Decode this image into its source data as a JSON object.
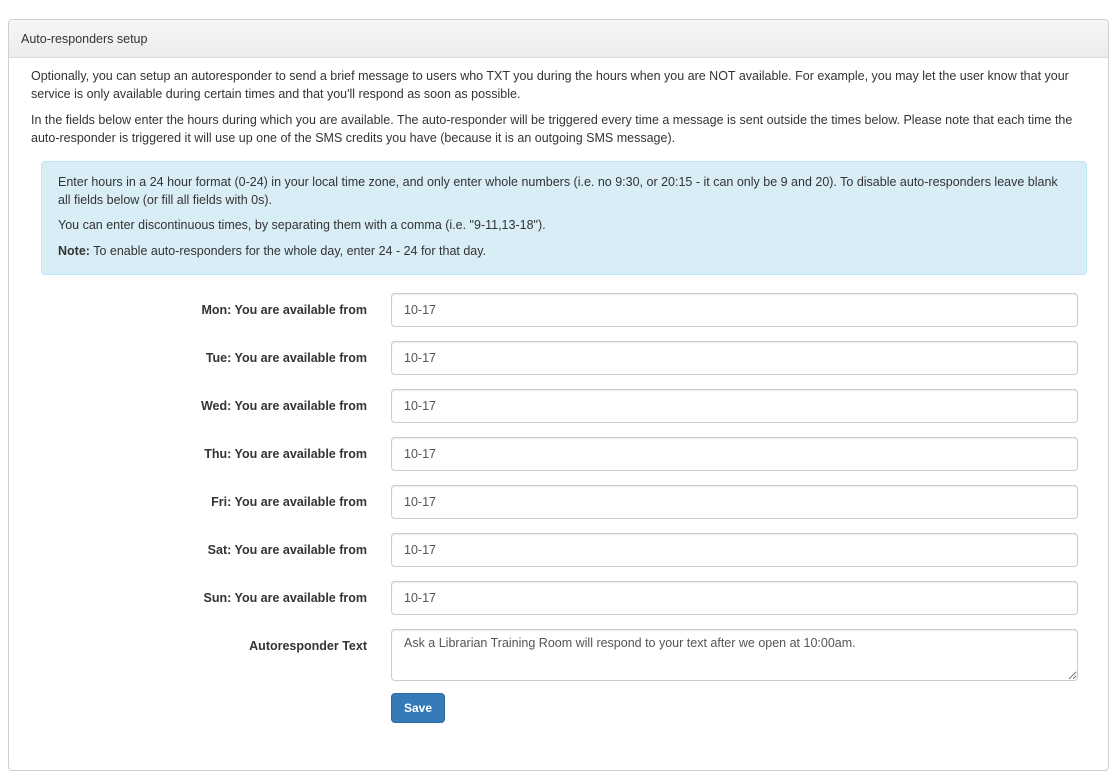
{
  "panel": {
    "title": "Auto-responders setup"
  },
  "intro": {
    "p1": "Optionally, you can setup an autoresponder to send a brief message to users who TXT you during the hours when you are NOT available. For example, you may let the user know that your service is only available during certain times and that you'll respond as soon as possible.",
    "p2": "In the fields below enter the hours during which you are available. The auto-responder will be triggered every time a message is sent outside the times below. Please note that each time the auto-responder is triggered it will use up one of the SMS credits you have (because it is an outgoing SMS message)."
  },
  "info": {
    "line1": "Enter hours in a 24 hour format (0-24) in your local time zone, and only enter whole numbers (i.e. no 9:30, or 20:15 - it can only be 9 and 20). To disable auto-responders leave blank all fields below (or fill all fields with 0s).",
    "line2": "You can enter discontinuous times, by separating them with a comma (i.e. \"9-11,13-18\").",
    "note_label": "Note:",
    "note_text": " To enable auto-responders for the whole day, enter 24 - 24 for that day."
  },
  "days": [
    {
      "label": "Mon: You are available from",
      "value": "10-17"
    },
    {
      "label": "Tue: You are available from",
      "value": "10-17"
    },
    {
      "label": "Wed: You are available from",
      "value": "10-17"
    },
    {
      "label": "Thu: You are available from",
      "value": "10-17"
    },
    {
      "label": "Fri: You are available from",
      "value": "10-17"
    },
    {
      "label": "Sat: You are available from",
      "value": "10-17"
    },
    {
      "label": "Sun: You are available from",
      "value": "10-17"
    }
  ],
  "autoresponder": {
    "label": "Autoresponder Text",
    "value": "Ask a Librarian Training Room will respond to your text after we open at 10:00am."
  },
  "save_label": "Save",
  "colors": {
    "primary": "#337ab7",
    "info_bg": "#d9edf7"
  }
}
